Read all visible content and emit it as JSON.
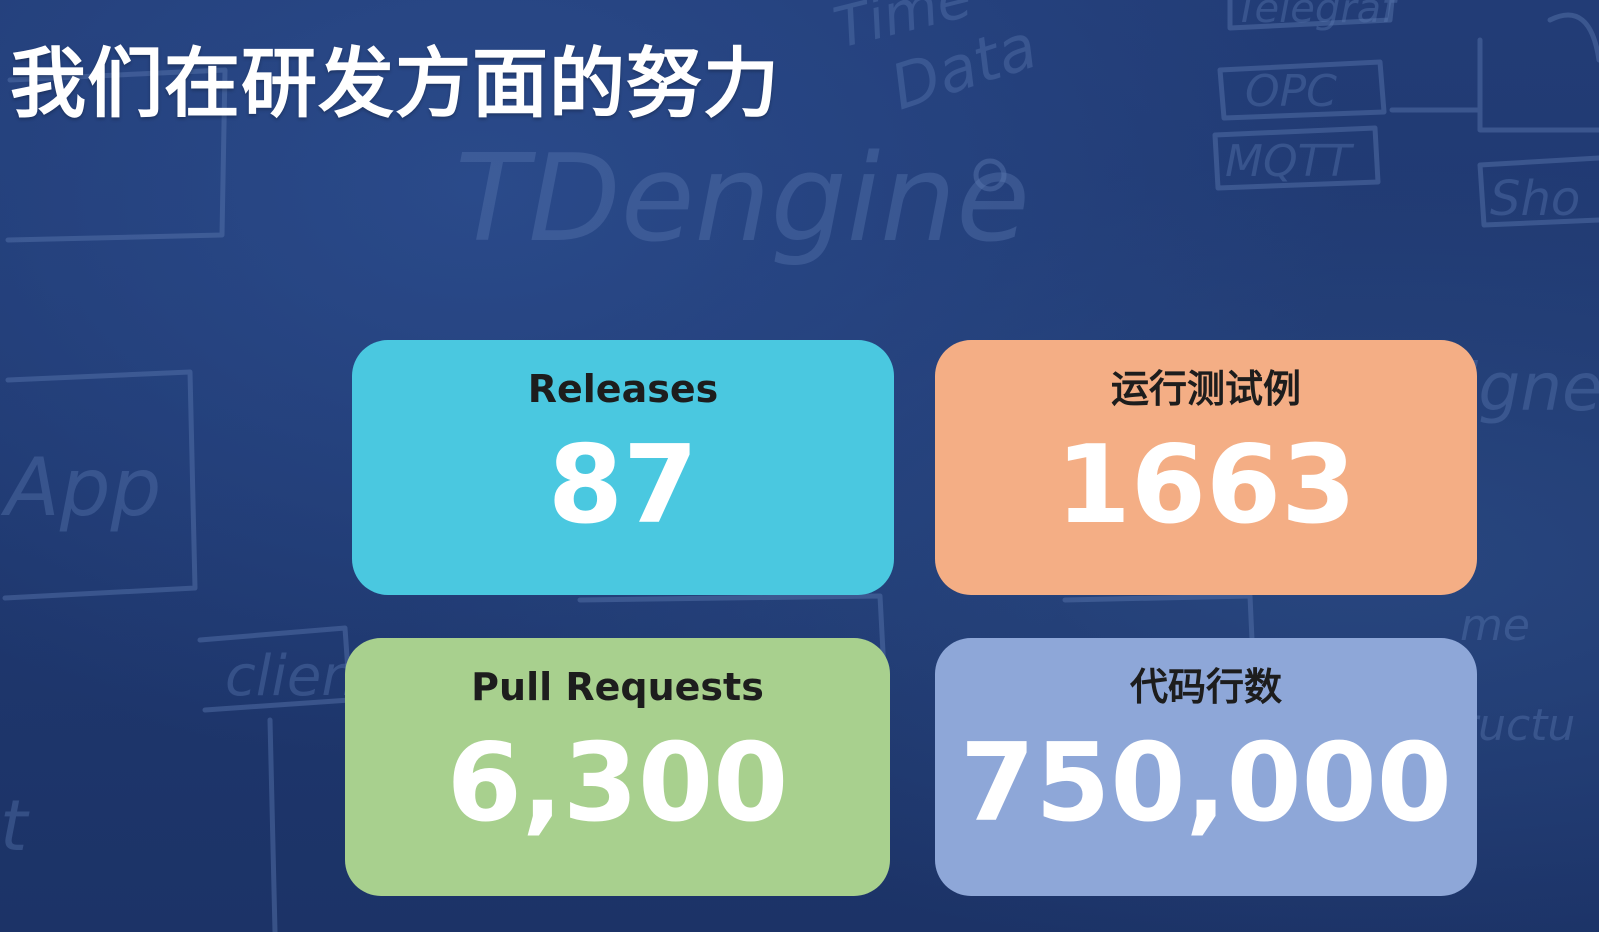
{
  "slide": {
    "title": "我们在研发方面的努力"
  },
  "colors": {
    "background": "#20386e",
    "releases_card": "#4ac8e0",
    "tests_card": "#f4ae85",
    "prs_card": "#a8d08e",
    "loc_card": "#8ea7d8"
  },
  "stats": [
    {
      "label": "Releases",
      "value": "87"
    },
    {
      "label": "运行测试例",
      "value": "1663"
    },
    {
      "label": "Pull Requests",
      "value": "6,300"
    },
    {
      "label": "代码行数",
      "value": "750,000"
    }
  ]
}
